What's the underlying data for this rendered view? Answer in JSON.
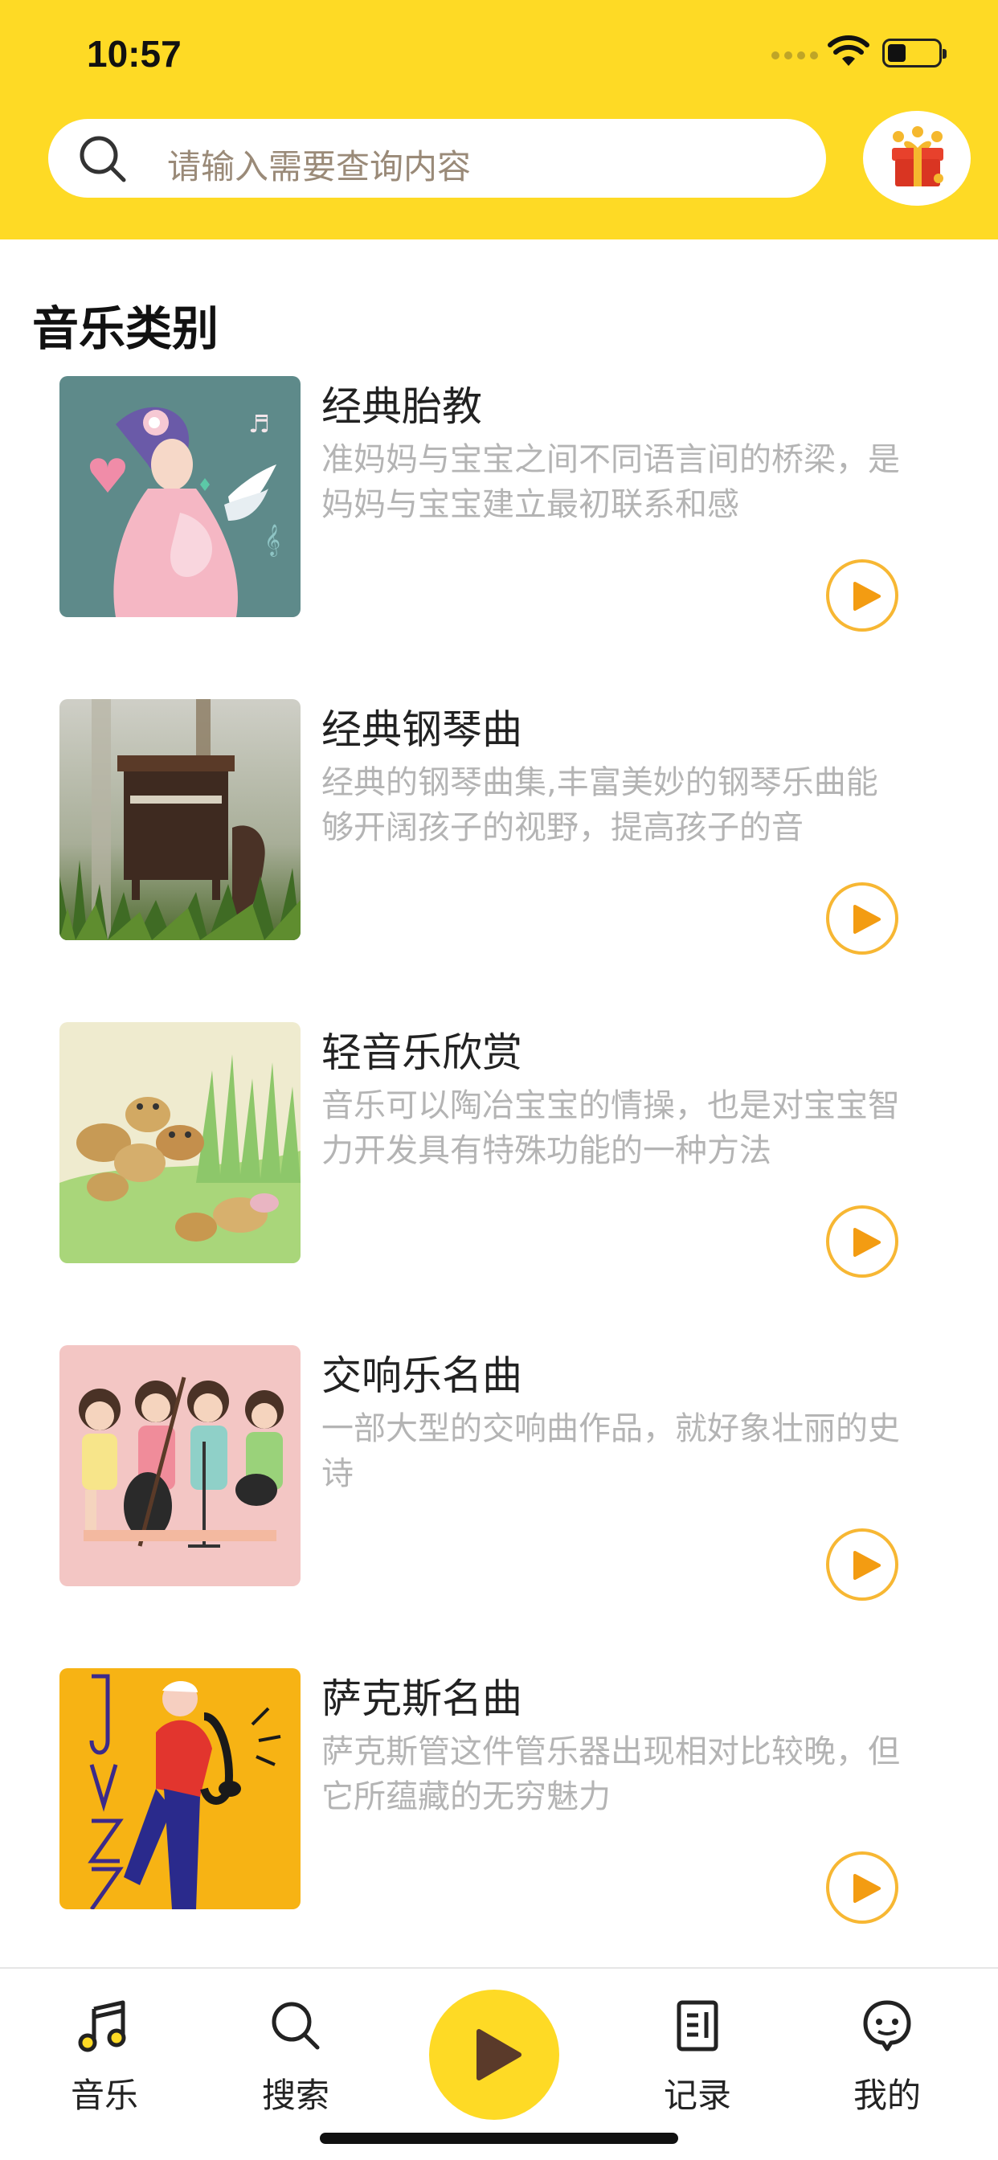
{
  "status_bar": {
    "time": "10:57"
  },
  "search": {
    "placeholder": "请输入需要查询内容"
  },
  "section": {
    "title": "音乐类别"
  },
  "categories": [
    {
      "title": "经典胎教",
      "desc": "准妈妈与宝宝之间不同语言间的桥梁，是妈妈与宝宝建立最初联系和感"
    },
    {
      "title": "经典钢琴曲",
      "desc": "经典的钢琴曲集,丰富美妙的钢琴乐曲能够开阔孩子的视野，提高孩子的音"
    },
    {
      "title": "轻音乐欣赏",
      "desc": "音乐可以陶冶宝宝的情操，也是对宝宝智力开发具有特殊功能的一种方法"
    },
    {
      "title": "交响乐名曲",
      "desc": "一部大型的交响曲作品，就好象壮丽的史诗"
    },
    {
      "title": "萨克斯名曲",
      "desc": "萨克斯管这件管乐器出现相对比较晚，但它所蕴藏的无穷魅力"
    }
  ],
  "tabs": [
    {
      "label": "音乐",
      "icon": "music-note-icon"
    },
    {
      "label": "搜索",
      "icon": "search-icon"
    },
    {
      "label": "记录",
      "icon": "record-icon"
    },
    {
      "label": "我的",
      "icon": "profile-icon"
    }
  ],
  "colors": {
    "brand": "#FEDA25",
    "accent": "#F7B733",
    "play_icon": "#F39C12",
    "desc_text": "#b4b4b4"
  }
}
